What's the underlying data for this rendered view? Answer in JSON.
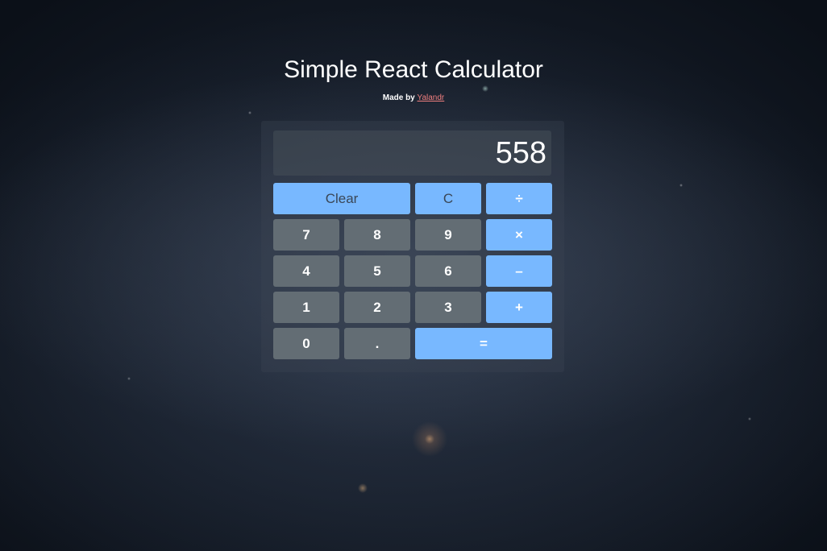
{
  "header": {
    "title": "Simple React Calculator",
    "made_by_prefix": "Made by ",
    "author_link": "Yalandr"
  },
  "display": {
    "value": "558"
  },
  "keys": {
    "clear": "Clear",
    "clear_entry": "C",
    "divide": "÷",
    "seven": "7",
    "eight": "8",
    "nine": "9",
    "multiply": "×",
    "four": "4",
    "five": "5",
    "six": "6",
    "subtract": "–",
    "one": "1",
    "two": "2",
    "three": "3",
    "add": "+",
    "zero": "0",
    "decimal": ".",
    "equals": "="
  },
  "colors": {
    "operator_key": "#78b8ff",
    "number_key": "#636d74",
    "author_link": "#f07f7f"
  }
}
